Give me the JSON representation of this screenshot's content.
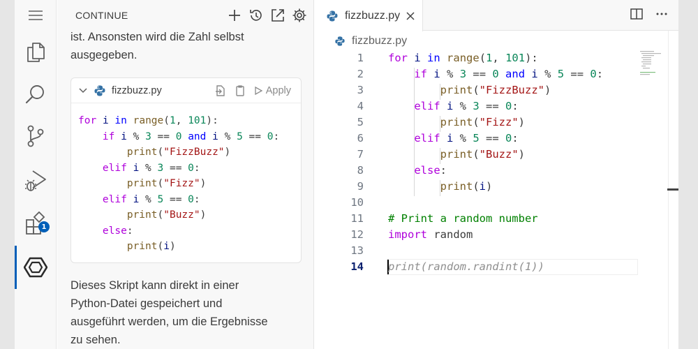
{
  "panel": {
    "title": "CONTINUE",
    "intro_line1": "ist. Ansonsten wird die Zahl selbst",
    "intro_line2": "ausgegeben.",
    "outro_line1": "Dieses Skript kann direkt in einer",
    "outro_line2": "Python-Datei gespeichert und",
    "outro_line3": "ausgeführt werden, um die Ergebnisse",
    "outro_line4": "zu sehen."
  },
  "snippet": {
    "filename": "fizzbuzz.py",
    "apply_label": "Apply",
    "lines": [
      "for i in range(1, 101):",
      "    if i % 3 == 0 and i % 5 == 0:",
      "        print(\"FizzBuzz\")",
      "    elif i % 3 == 0:",
      "        print(\"Fizz\")",
      "    elif i % 5 == 0:",
      "        print(\"Buzz\")",
      "    else:",
      "        print(i)"
    ]
  },
  "activity_bar": {
    "extensions_badge": "1",
    "icons": [
      "explorer-icon",
      "search-icon",
      "source-control-icon",
      "run-debug-icon",
      "extensions-icon",
      "continue-icon"
    ]
  },
  "editor": {
    "tab_label": "fizzbuzz.py",
    "breadcrumb": "fizzbuzz.py",
    "current_line": "14",
    "ghost_suggestion": "print(random.randint(1))",
    "line_numbers": [
      "1",
      "2",
      "3",
      "4",
      "5",
      "6",
      "7",
      "8",
      "9",
      "10",
      "11",
      "12",
      "13",
      "14"
    ],
    "lines": [
      "for i in range(1, 101):",
      "    if i % 3 == 0 and i % 5 == 0:",
      "        print(\"FizzBuzz\")",
      "    elif i % 3 == 0:",
      "        print(\"Fizz\")",
      "    elif i % 5 == 0:",
      "        print(\"Buzz\")",
      "    else:",
      "        print(i)",
      "",
      "# Print a random number",
      "import random",
      "",
      ""
    ]
  },
  "colors": {
    "accent": "#005fb8",
    "keyword": "#0000ff",
    "control": "#af00db",
    "function": "#795e26",
    "number": "#098658",
    "string": "#a31515",
    "comment": "#008000"
  }
}
